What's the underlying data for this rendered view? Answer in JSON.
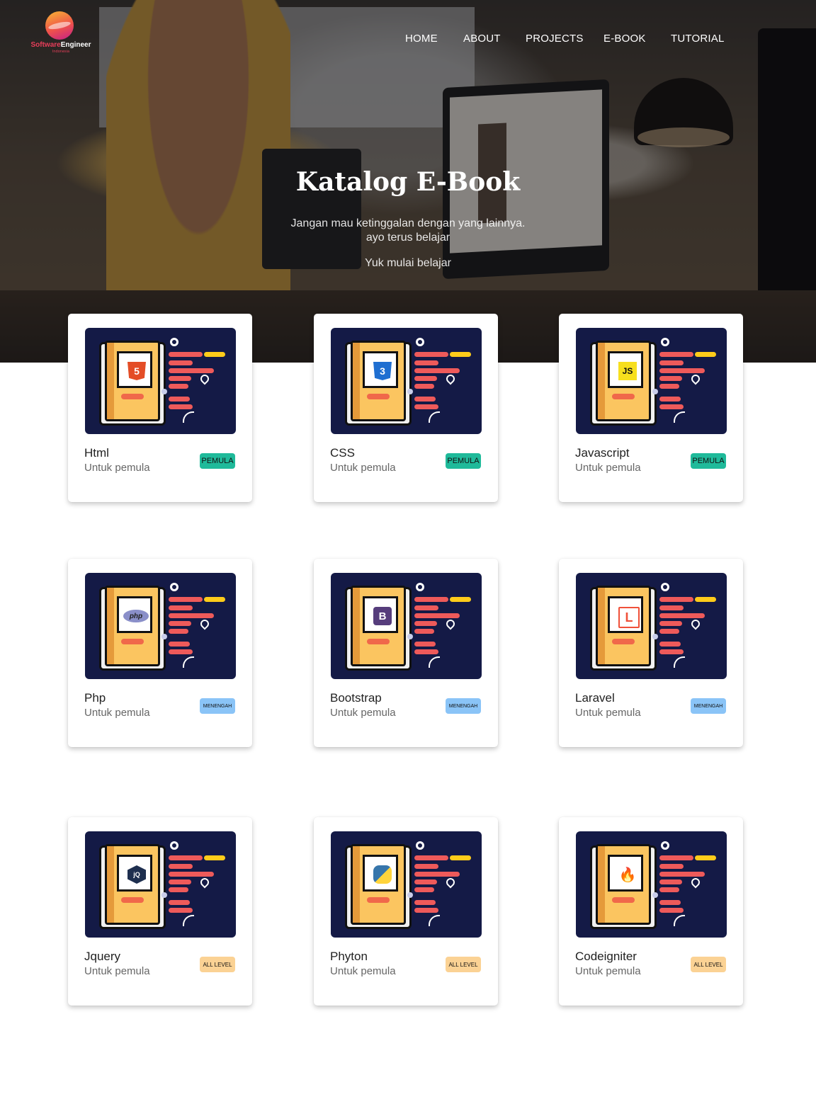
{
  "brand": {
    "name_part1": "Software",
    "name_part2": "Engineer",
    "tagline": "Indonesia"
  },
  "nav": {
    "items": [
      "HOME",
      "ABOUT",
      "PROJECTS",
      "E-BOOK",
      "TUTORIAL"
    ]
  },
  "hero": {
    "title": "Katalog E-Book",
    "subtitle_line1": "Jangan mau ketinggalan dengan yang lainnya.",
    "subtitle_line2": "ayo terus belajar",
    "cta": "Yuk mulai belajar"
  },
  "colors": {
    "pemula": "#1fba9a",
    "menengah": "#8ac4f7",
    "all_level": "#fbd294",
    "thumb_bg": "#141a46"
  },
  "cards": [
    {
      "title": "Html",
      "subtitle": "Untuk pemula",
      "badge": "PEMULA",
      "icon": "html5-icon"
    },
    {
      "title": "CSS",
      "subtitle": "Untuk pemula",
      "badge": "PEMULA",
      "icon": "css3-icon"
    },
    {
      "title": "Javascript",
      "subtitle": "Untuk pemula",
      "badge": "PEMULA",
      "icon": "javascript-icon"
    },
    {
      "title": "Php",
      "subtitle": "Untuk pemula",
      "badge": "MENENGAH",
      "icon": "php-icon"
    },
    {
      "title": "Bootstrap",
      "subtitle": "Untuk pemula",
      "badge": "MENENGAH",
      "icon": "bootstrap-icon"
    },
    {
      "title": "Laravel",
      "subtitle": "Untuk pemula",
      "badge": "MENENGAH",
      "icon": "laravel-icon"
    },
    {
      "title": "Jquery",
      "subtitle": "Untuk pemula",
      "badge": "ALL LEVEL",
      "icon": "jquery-icon"
    },
    {
      "title": "Phyton",
      "subtitle": "Untuk pemula",
      "badge": "ALL LEVEL",
      "icon": "python-icon"
    },
    {
      "title": "Codeigniter",
      "subtitle": "Untuk pemula",
      "badge": "ALL LEVEL",
      "icon": "codeigniter-icon"
    }
  ]
}
